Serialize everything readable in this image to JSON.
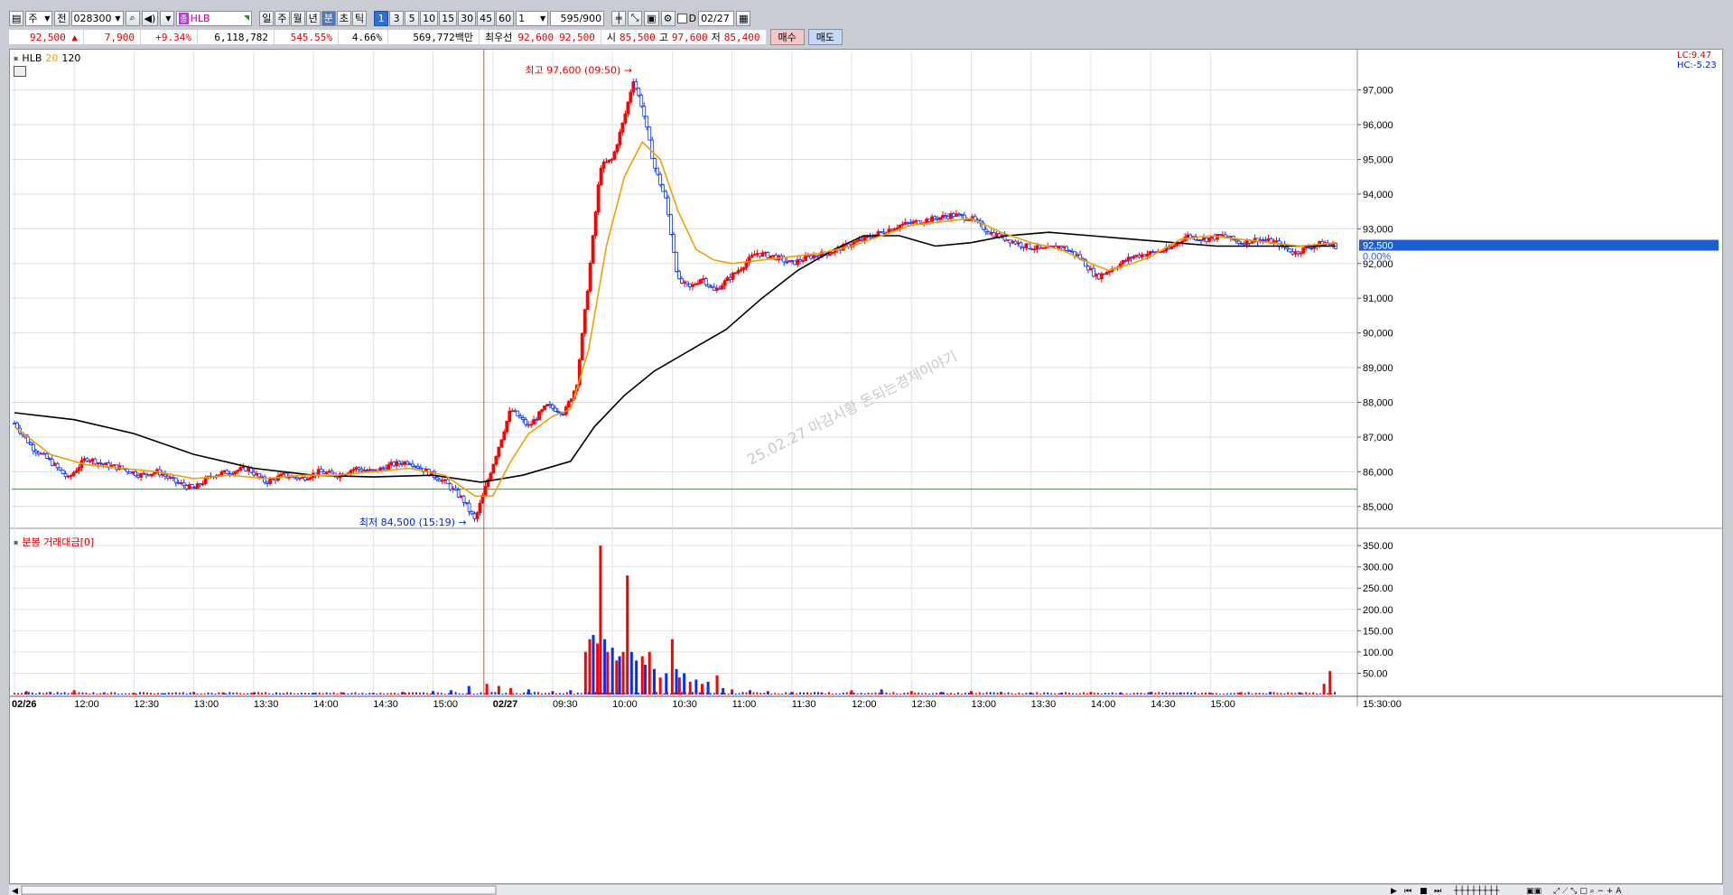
{
  "toolbar": {
    "market_label": "주",
    "market2_label": "전",
    "code": "028300",
    "stock_badge": "종",
    "stock_name": "HLB",
    "period_buttons": [
      "일",
      "주",
      "월",
      "년",
      "분",
      "초",
      "틱"
    ],
    "active_period": "분",
    "interval_buttons": [
      "1",
      "3",
      "5",
      "10",
      "15",
      "30",
      "45",
      "60"
    ],
    "active_interval": "1",
    "interval_select": "1",
    "bar_count": "595",
    "bar_total": "/900",
    "date_check_label": "D",
    "date": "02/27"
  },
  "infobar": {
    "price": "92,500",
    "change_arrow": "▲",
    "change": "7,900",
    "change_pct": "+9.34%",
    "volume": "6,118,782",
    "volume_ratio": "545.55%",
    "turnover": "4.66%",
    "amount": "569,772백만",
    "best_ask_label": "최우선",
    "best_ask": "92,600",
    "best_bid": "92,500",
    "open_label": "시",
    "open": "85,500",
    "high_label": "고",
    "high": "97,600",
    "low_label": "저",
    "low": "85,400",
    "buy_button": "매수",
    "sell_button": "매도"
  },
  "price_pane": {
    "legend_name": "HLB",
    "legend_ma1": "20",
    "legend_ma2": "120",
    "lc_label": "LC:9.47",
    "hc_label": "HC:-5.23",
    "current_price_tag": "92,500",
    "current_pct_tag": "0.00%",
    "high_annotation": "최고 97,600 (09:50)",
    "low_annotation": "최저 84,500 (15:19)",
    "watermark": "25.02.27 마감시황 돈되는경제이야기",
    "colors": {
      "up": "#ff0000",
      "down": "#0030ff",
      "ma20": "#f0a000",
      "ma120": "#000000",
      "hline": "#00dd00"
    }
  },
  "volume_pane": {
    "legend": "분봉 거래대금[0]"
  },
  "chart_data": [
    {
      "type": "candlestick",
      "title": "HLB",
      "x_ticks": [
        "02/26",
        "12:00",
        "12:30",
        "13:00",
        "13:30",
        "14:00",
        "14:30",
        "15:00",
        "02/27",
        "09:30",
        "10:00",
        "10:30",
        "11:00",
        "11:30",
        "12:00",
        "12:30",
        "13:00",
        "13:30",
        "14:00",
        "14:30",
        "15:00",
        "15:30:00"
      ],
      "y_ticks": [
        85000,
        86000,
        87000,
        88000,
        89000,
        90000,
        91000,
        92000,
        93000,
        94000,
        95000,
        96000,
        97000
      ],
      "ylim": [
        84500,
        97900
      ],
      "reference_line": 85500,
      "close_series": [
        [
          0,
          87400
        ],
        [
          0.3,
          86700
        ],
        [
          0.6,
          86300
        ],
        [
          0.9,
          85800
        ],
        [
          1.2,
          86400
        ],
        [
          1.5,
          86200
        ],
        [
          1.8,
          86100
        ],
        [
          2.1,
          85900
        ],
        [
          2.4,
          86000
        ],
        [
          2.7,
          85700
        ],
        [
          3.0,
          85500
        ],
        [
          3.3,
          85900
        ],
        [
          3.6,
          86000
        ],
        [
          3.9,
          86100
        ],
        [
          4.2,
          85700
        ],
        [
          4.5,
          85900
        ],
        [
          4.8,
          85800
        ],
        [
          5.1,
          86000
        ],
        [
          5.4,
          85900
        ],
        [
          5.7,
          86100
        ],
        [
          6.0,
          86000
        ],
        [
          6.3,
          86200
        ],
        [
          6.6,
          86300
        ],
        [
          6.9,
          86000
        ],
        [
          7.2,
          85700
        ],
        [
          7.5,
          85200
        ],
        [
          7.7,
          84600
        ],
        [
          8.0,
          86200
        ],
        [
          8.3,
          87800
        ],
        [
          8.6,
          87300
        ],
        [
          8.9,
          87900
        ],
        [
          9.2,
          87700
        ],
        [
          9.4,
          88500
        ],
        [
          9.6,
          91500
        ],
        [
          9.8,
          94800
        ],
        [
          10.0,
          95000
        ],
        [
          10.2,
          96200
        ],
        [
          10.35,
          97300
        ],
        [
          10.5,
          96500
        ],
        [
          10.7,
          94800
        ],
        [
          10.9,
          93800
        ],
        [
          11.1,
          91500
        ],
        [
          11.3,
          91300
        ],
        [
          11.5,
          91600
        ],
        [
          11.7,
          91200
        ],
        [
          11.9,
          91500
        ],
        [
          12.1,
          91800
        ],
        [
          12.4,
          92300
        ],
        [
          12.7,
          92200
        ],
        [
          13.0,
          92000
        ],
        [
          13.3,
          92200
        ],
        [
          13.6,
          92300
        ],
        [
          13.9,
          92500
        ],
        [
          14.2,
          92700
        ],
        [
          14.5,
          92900
        ],
        [
          14.8,
          93100
        ],
        [
          15.1,
          93200
        ],
        [
          15.4,
          93300
        ],
        [
          15.7,
          93400
        ],
        [
          16.0,
          93300
        ],
        [
          16.3,
          92900
        ],
        [
          16.6,
          92700
        ],
        [
          16.9,
          92500
        ],
        [
          17.2,
          92400
        ],
        [
          17.5,
          92500
        ],
        [
          17.8,
          92200
        ],
        [
          18.1,
          91600
        ],
        [
          18.4,
          91900
        ],
        [
          18.7,
          92200
        ],
        [
          19.0,
          92300
        ],
        [
          19.3,
          92400
        ],
        [
          19.6,
          92800
        ],
        [
          19.9,
          92700
        ],
        [
          20.2,
          92800
        ],
        [
          20.5,
          92600
        ],
        [
          20.8,
          92700
        ],
        [
          21.1,
          92600
        ],
        [
          21.4,
          92300
        ],
        [
          21.7,
          92500
        ],
        [
          21.9,
          92600
        ],
        [
          22.1,
          92500
        ]
      ],
      "ma20_series": [
        [
          0,
          87300
        ],
        [
          0.6,
          86500
        ],
        [
          1.2,
          86200
        ],
        [
          1.8,
          86100
        ],
        [
          2.4,
          86000
        ],
        [
          3.0,
          85800
        ],
        [
          3.6,
          85900
        ],
        [
          4.2,
          85800
        ],
        [
          4.8,
          85900
        ],
        [
          5.4,
          85900
        ],
        [
          6.0,
          86000
        ],
        [
          6.6,
          86100
        ],
        [
          7.2,
          85900
        ],
        [
          7.7,
          85300
        ],
        [
          8.0,
          85300
        ],
        [
          8.3,
          86300
        ],
        [
          8.6,
          87100
        ],
        [
          9.0,
          87600
        ],
        [
          9.3,
          87800
        ],
        [
          9.6,
          89500
        ],
        [
          9.9,
          92500
        ],
        [
          10.2,
          94500
        ],
        [
          10.5,
          95500
        ],
        [
          10.8,
          95000
        ],
        [
          11.1,
          93500
        ],
        [
          11.4,
          92400
        ],
        [
          11.7,
          92100
        ],
        [
          12.0,
          92000
        ],
        [
          12.5,
          92100
        ],
        [
          13.0,
          92200
        ],
        [
          13.5,
          92300
        ],
        [
          14.0,
          92500
        ],
        [
          14.5,
          92800
        ],
        [
          15.0,
          93100
        ],
        [
          15.5,
          93200
        ],
        [
          16.0,
          93300
        ],
        [
          16.5,
          92900
        ],
        [
          17.0,
          92600
        ],
        [
          17.5,
          92400
        ],
        [
          18.0,
          92000
        ],
        [
          18.3,
          91800
        ],
        [
          18.7,
          92000
        ],
        [
          19.0,
          92200
        ],
        [
          19.5,
          92700
        ],
        [
          20.0,
          92800
        ],
        [
          20.5,
          92700
        ],
        [
          21.0,
          92600
        ],
        [
          21.5,
          92500
        ],
        [
          22.1,
          92600
        ]
      ],
      "ma120_series": [
        [
          0,
          87700
        ],
        [
          1.0,
          87500
        ],
        [
          2.0,
          87100
        ],
        [
          3.0,
          86500
        ],
        [
          4.0,
          86100
        ],
        [
          5.0,
          85900
        ],
        [
          6.0,
          85850
        ],
        [
          7.0,
          85900
        ],
        [
          7.8,
          85700
        ],
        [
          8.5,
          85900
        ],
        [
          9.3,
          86300
        ],
        [
          9.7,
          87300
        ],
        [
          10.2,
          88200
        ],
        [
          10.7,
          88900
        ],
        [
          11.3,
          89500
        ],
        [
          11.9,
          90100
        ],
        [
          12.5,
          91000
        ],
        [
          13.1,
          91800
        ],
        [
          13.7,
          92400
        ],
        [
          14.2,
          92800
        ],
        [
          14.8,
          92800
        ],
        [
          15.4,
          92500
        ],
        [
          16.0,
          92600
        ],
        [
          16.6,
          92800
        ],
        [
          17.3,
          92900
        ],
        [
          18.0,
          92800
        ],
        [
          18.7,
          92700
        ],
        [
          19.4,
          92600
        ],
        [
          20.1,
          92500
        ],
        [
          20.8,
          92500
        ],
        [
          21.5,
          92500
        ],
        [
          22.1,
          92500
        ]
      ]
    },
    {
      "type": "bar",
      "title": "분봉 거래대금[0]",
      "y_ticks": [
        50,
        100,
        150,
        200,
        250,
        300,
        350
      ],
      "ylim": [
        0,
        380
      ],
      "bars": [
        [
          0.2,
          8,
          "up"
        ],
        [
          0.6,
          6,
          "down"
        ],
        [
          1.0,
          10,
          "up"
        ],
        [
          1.5,
          5,
          "down"
        ],
        [
          2.0,
          4,
          "up"
        ],
        [
          2.5,
          3,
          "down"
        ],
        [
          3.0,
          6,
          "up"
        ],
        [
          3.5,
          4,
          "down"
        ],
        [
          4.0,
          5,
          "up"
        ],
        [
          4.5,
          3,
          "up"
        ],
        [
          5.0,
          4,
          "down"
        ],
        [
          5.5,
          5,
          "up"
        ],
        [
          6.0,
          4,
          "down"
        ],
        [
          6.5,
          6,
          "up"
        ],
        [
          7.0,
          8,
          "down"
        ],
        [
          7.3,
          10,
          "down"
        ],
        [
          7.6,
          20,
          "down"
        ],
        [
          7.9,
          25,
          "up"
        ],
        [
          8.1,
          20,
          "up"
        ],
        [
          8.3,
          15,
          "up"
        ],
        [
          8.6,
          12,
          "down"
        ],
        [
          9.0,
          8,
          "up"
        ],
        [
          9.3,
          10,
          "down"
        ],
        [
          9.55,
          100,
          "up"
        ],
        [
          9.62,
          130,
          "up"
        ],
        [
          9.68,
          140,
          "down"
        ],
        [
          9.75,
          120,
          "up"
        ],
        [
          9.8,
          350,
          "up"
        ],
        [
          9.87,
          130,
          "down"
        ],
        [
          9.92,
          100,
          "up"
        ],
        [
          10.0,
          110,
          "down"
        ],
        [
          10.07,
          80,
          "up"
        ],
        [
          10.12,
          90,
          "down"
        ],
        [
          10.18,
          100,
          "up"
        ],
        [
          10.25,
          280,
          "up"
        ],
        [
          10.32,
          100,
          "down"
        ],
        [
          10.4,
          80,
          "down"
        ],
        [
          10.5,
          90,
          "up"
        ],
        [
          10.55,
          70,
          "down"
        ],
        [
          10.62,
          100,
          "up"
        ],
        [
          10.7,
          60,
          "down"
        ],
        [
          10.8,
          40,
          "up"
        ],
        [
          10.9,
          50,
          "down"
        ],
        [
          11.0,
          130,
          "up"
        ],
        [
          11.07,
          60,
          "down"
        ],
        [
          11.12,
          40,
          "up"
        ],
        [
          11.2,
          50,
          "down"
        ],
        [
          11.3,
          30,
          "up"
        ],
        [
          11.4,
          35,
          "down"
        ],
        [
          11.5,
          25,
          "up"
        ],
        [
          11.6,
          30,
          "down"
        ],
        [
          11.75,
          45,
          "up"
        ],
        [
          11.85,
          15,
          "down"
        ],
        [
          12.0,
          12,
          "up"
        ],
        [
          12.3,
          10,
          "down"
        ],
        [
          12.6,
          8,
          "up"
        ],
        [
          13.0,
          6,
          "down"
        ],
        [
          13.5,
          5,
          "up"
        ],
        [
          14.0,
          10,
          "up"
        ],
        [
          14.5,
          12,
          "down"
        ],
        [
          15.0,
          8,
          "up"
        ],
        [
          15.5,
          6,
          "down"
        ],
        [
          16.0,
          8,
          "up"
        ],
        [
          16.5,
          6,
          "down"
        ],
        [
          17.0,
          5,
          "up"
        ],
        [
          17.5,
          4,
          "down"
        ],
        [
          18.0,
          6,
          "up"
        ],
        [
          18.5,
          5,
          "down"
        ],
        [
          19.0,
          6,
          "up"
        ],
        [
          19.5,
          5,
          "down"
        ],
        [
          20.0,
          4,
          "up"
        ],
        [
          20.5,
          5,
          "up"
        ],
        [
          21.0,
          6,
          "down"
        ],
        [
          21.5,
          5,
          "up"
        ],
        [
          21.9,
          25,
          "up"
        ],
        [
          22.0,
          55,
          "up"
        ]
      ]
    }
  ]
}
